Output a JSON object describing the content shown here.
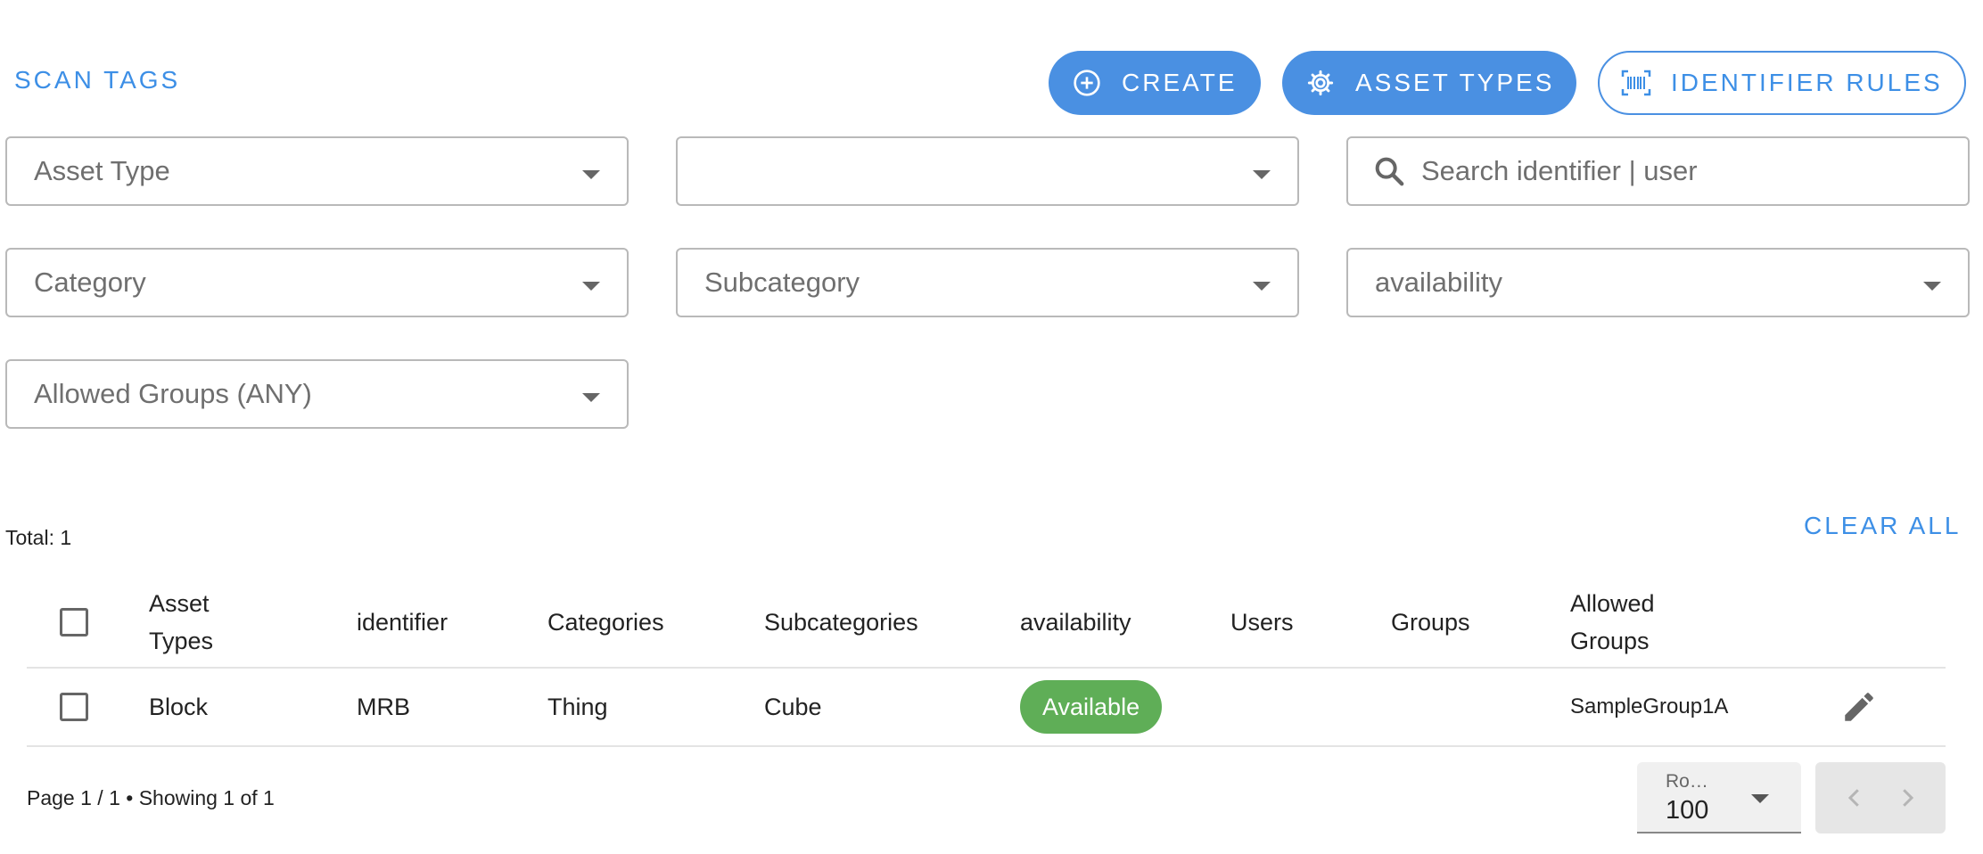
{
  "header": {
    "scan_tags": "SCAN TAGS",
    "create": "CREATE",
    "asset_types": "ASSET TYPES",
    "identifier_rules": "IDENTIFIER RULES"
  },
  "filters": {
    "asset_type": "Asset Type",
    "second_select": "",
    "search_placeholder": "Search identifier | user",
    "category": "Category",
    "subcategory": "Subcategory",
    "availability": "availability",
    "allowed_groups": "Allowed Groups (ANY)"
  },
  "summary": {
    "total": "Total: 1",
    "clear_all": "CLEAR ALL"
  },
  "table": {
    "columns": {
      "asset_types_1": "Asset",
      "asset_types_2": "Types",
      "identifier": "identifier",
      "categories": "Categories",
      "subcategories": "Subcategories",
      "availability": "availability",
      "users": "Users",
      "groups": "Groups",
      "allowed_groups_1": "Allowed",
      "allowed_groups_2": "Groups"
    },
    "rows": [
      {
        "asset_type": "Block",
        "identifier": "MRB",
        "category": "Thing",
        "subcategory": "Cube",
        "availability": "Available",
        "users": "",
        "groups": "",
        "allowed_groups": "SampleGroup1A"
      }
    ]
  },
  "footer": {
    "page_info": "Page 1 / 1 • Showing 1 of 1",
    "rows_label": "Ro…",
    "rows_value": "100"
  },
  "colors": {
    "accent": "#4a90e2",
    "link": "#3d8fe6",
    "available": "#5fae57"
  },
  "icons": [
    "plus-circle-icon",
    "gear-icon",
    "barcode-icon",
    "search-icon",
    "edit-pencil-icon",
    "chevron-left-icon",
    "chevron-right-icon",
    "caret-down-icon"
  ]
}
